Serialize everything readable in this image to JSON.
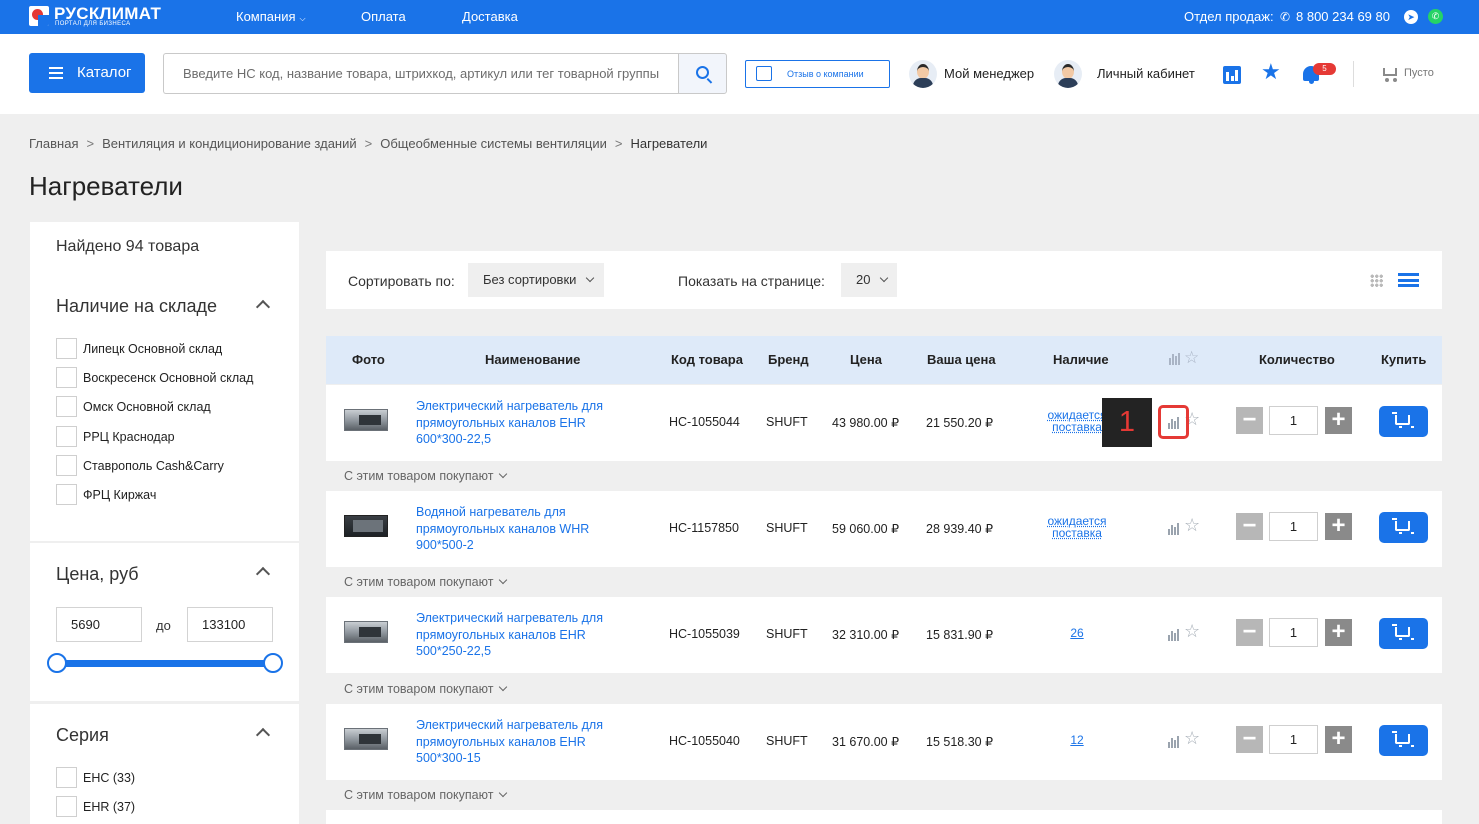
{
  "topbar": {
    "logo_name": "РУСКЛИМАТ",
    "logo_sub": "ПОРТАЛ ДЛЯ БИЗНЕСА",
    "nav": [
      "Компания",
      "Оплата",
      "Доставка"
    ],
    "sales_label": "Отдел продаж:",
    "phone": "8 800 234 69 80"
  },
  "header": {
    "catalog_label": "Каталог",
    "search_placeholder": "Введите НС код, название товара, штрихкод, артикул или тег товарной группы",
    "review_label": "Отзыв о компании",
    "manager_label": "Мой менеджер",
    "account_label": "Личный кабинет",
    "notifications_count": "5",
    "cart_label": "Пусто"
  },
  "breadcrumb": {
    "items": [
      "Главная",
      "Вентиляция и кондиционирование зданий",
      "Общеобменные системы вентиляции"
    ],
    "current": "Нагреватели",
    "separator": ">"
  },
  "page_title": "Нагреватели",
  "sidebar": {
    "found": "Найдено 94 товара",
    "stock": {
      "title": "Наличие на складе",
      "options": [
        "Липецк Основной склад",
        "Воскресенск Основной склад",
        "Омск Основной склад",
        "РРЦ Краснодар",
        "Ставрополь Cash&Carry",
        "ФРЦ Киржач"
      ]
    },
    "price": {
      "title": "Цена, руб",
      "min": "5690",
      "to": "до",
      "max": "133100"
    },
    "series": {
      "title": "Серия",
      "options": [
        "EHC (33)",
        "EHR (37)"
      ]
    }
  },
  "toolbar": {
    "sort_label": "Сортировать по:",
    "sort_value": "Без сортировки",
    "per_page_label": "Показать на странице:",
    "per_page_value": "20"
  },
  "table": {
    "headers": [
      "Фото",
      "Наименование",
      "Код товара",
      "Бренд",
      "Цена",
      "Ваша цена",
      "Наличие",
      "Количество",
      "Купить"
    ],
    "also_label": "С этим товаром покупают",
    "rows": [
      {
        "name": "Электрический нагреватель для прямоугольных каналов EHR 600*300-22,5",
        "code": "НС-1055044",
        "brand": "SHUFT",
        "price": "43 980.00 ₽",
        "your_price": "21 550.20 ₽",
        "availability": "ожидается поставка",
        "qty": "1"
      },
      {
        "name": "Водяной нагреватель для прямоугольных каналов WHR 900*500-2",
        "code": "НС-1157850",
        "brand": "SHUFT",
        "price": "59 060.00 ₽",
        "your_price": "28 939.40 ₽",
        "availability": "ожидается поставка",
        "qty": "1"
      },
      {
        "name": "Электрический нагреватель для прямоугольных каналов EHR 500*250-22,5",
        "code": "НС-1055039",
        "brand": "SHUFT",
        "price": "32 310.00 ₽",
        "your_price": "15 831.90 ₽",
        "availability": "26",
        "qty": "1"
      },
      {
        "name": "Электрический нагреватель для прямоугольных каналов EHR 500*300-15",
        "code": "НС-1055040",
        "brand": "SHUFT",
        "price": "31 670.00 ₽",
        "your_price": "15 518.30 ₽",
        "availability": "12",
        "qty": "1"
      }
    ]
  },
  "annotation": {
    "marker_label": "1"
  },
  "colors": {
    "accent": "#1a73e8",
    "marker": "#e53935",
    "table_header_bg": "#deeaf9",
    "page_bg": "#efefef"
  },
  "icons": [
    "logo-icon",
    "chevron-down-icon",
    "phone-icon",
    "telegram-icon",
    "whatsapp-icon",
    "menu-icon",
    "search-icon",
    "thumbs-up-icon",
    "manager-avatar",
    "account-avatar",
    "stats-icon",
    "star-icon",
    "bell-icon",
    "cart-icon",
    "chevron-up-icon",
    "grid-view-icon",
    "list-view-icon",
    "compare-icon",
    "favorite-star-icon",
    "minus-icon",
    "plus-icon",
    "add-to-cart-icon"
  ]
}
